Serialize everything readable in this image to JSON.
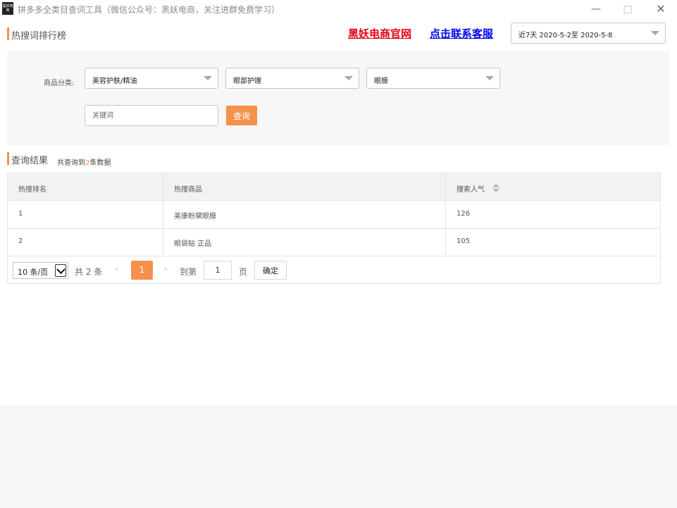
{
  "window": {
    "title": "拼多多全类目查词工具（微信公众号：黑妖电商，关注进群免费学习）",
    "logo_text": "黑妖电商",
    "controls": {
      "minimize": "—",
      "maximize": "□",
      "close": "✕"
    }
  },
  "header": {
    "section_title": "热搜词排行榜",
    "link_official": "黑妖电商官网",
    "link_service": "点击联系客服",
    "date_range": "近7天 2020-5-2至 2020-5-8"
  },
  "filters": {
    "label": "商品分类:",
    "category_1": "美容护肤/精油",
    "category_2": "眼部护理",
    "category_3": "眼膜",
    "keyword_placeholder": "关键词",
    "keyword_value": "",
    "query_button": "查询"
  },
  "results": {
    "section_title": "查询结果",
    "count_prefix": "共查询到",
    "count": "2",
    "count_suffix": "条数据"
  },
  "table": {
    "columns": [
      "热搜排名",
      "热搜商品",
      "搜索人气"
    ],
    "rows": [
      {
        "rank": "1",
        "product": "美康粉黛眼膜",
        "popularity": "126"
      },
      {
        "rank": "2",
        "product": "眼袋贴 正品",
        "popularity": "105"
      }
    ]
  },
  "pagination": {
    "page_size": "10 条/页",
    "total": "共 2 条",
    "prev": "‹",
    "current_page": "1",
    "next": "›",
    "goto_label": "到第",
    "goto_value": "1",
    "page_unit": "页",
    "confirm": "确定"
  },
  "colors": {
    "accent": "#f5914a",
    "link_red": "#e60012",
    "link_blue": "#0000ee"
  }
}
